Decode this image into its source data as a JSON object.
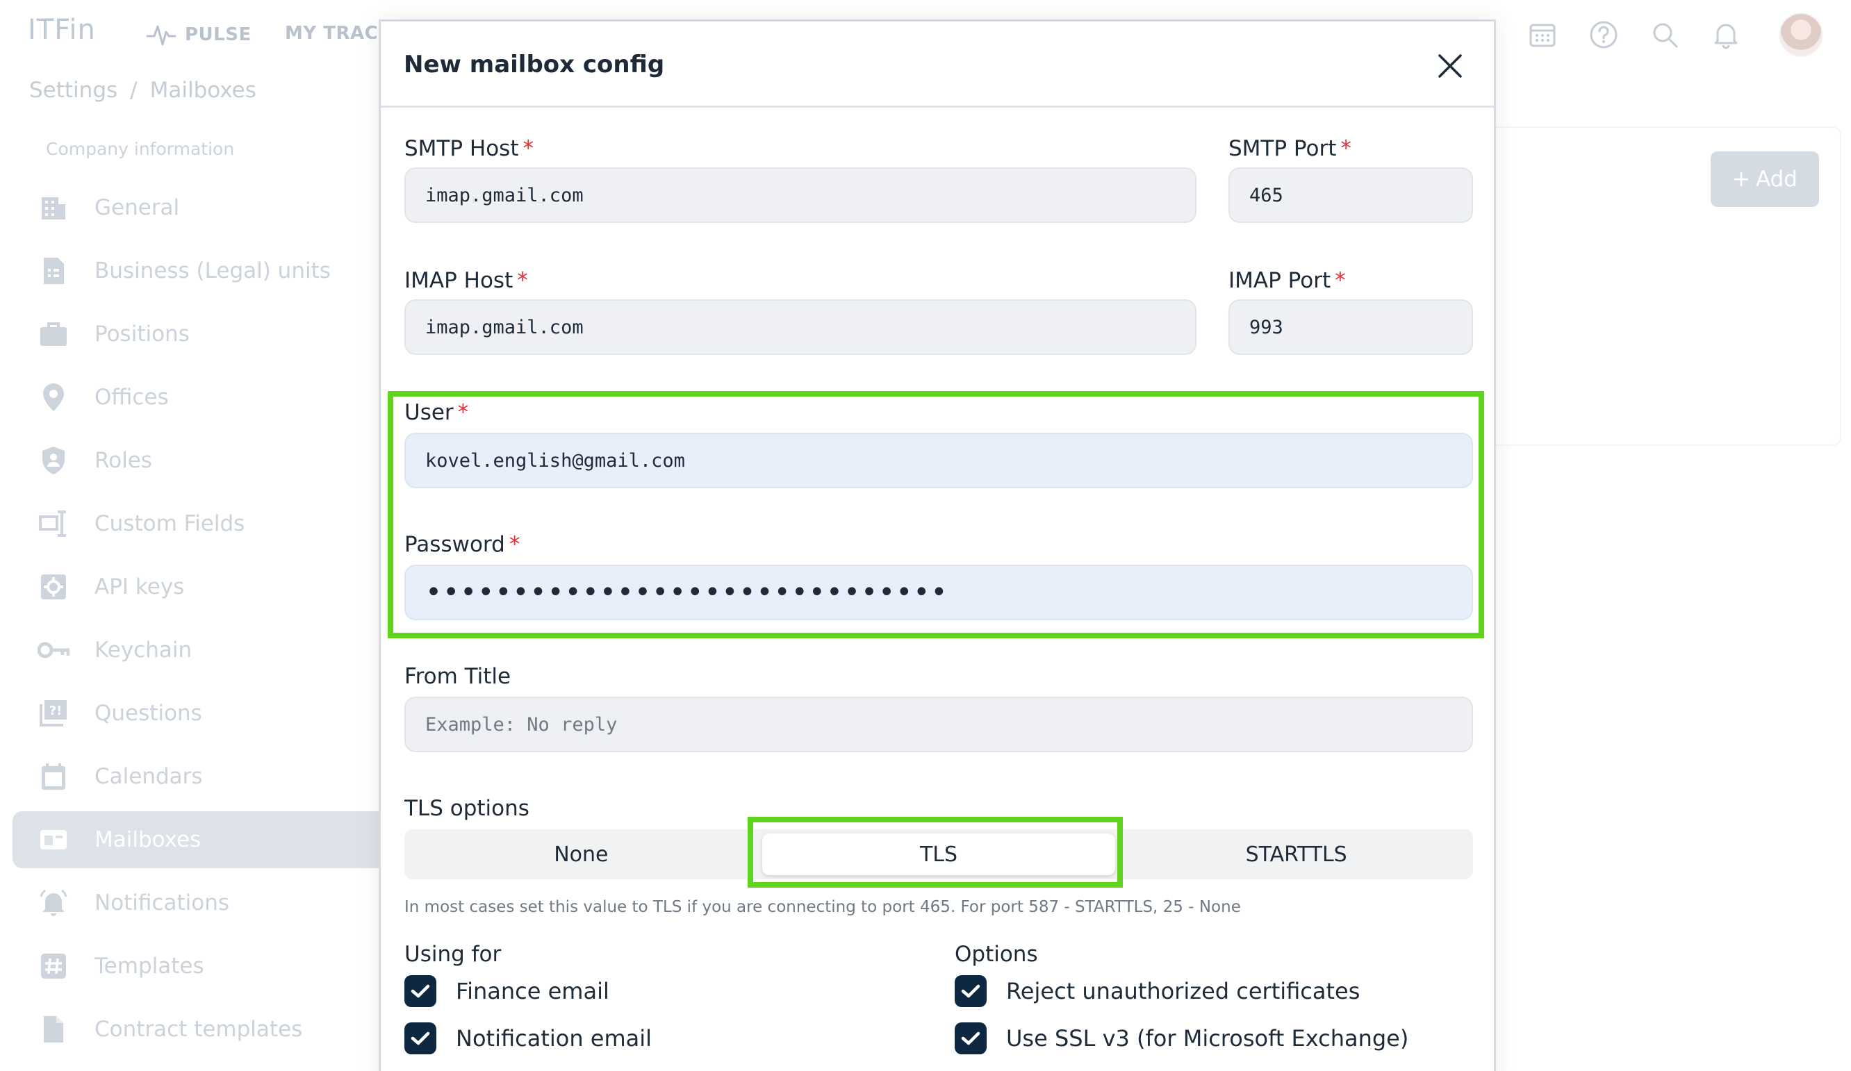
{
  "app": {
    "logo": "ITFin",
    "nav_pulse": "PULSE",
    "nav_tracker": "MY TRACKER"
  },
  "breadcrumb": {
    "root": "Settings",
    "separator": "/",
    "current": "Mailboxes"
  },
  "sidebar": {
    "heading": "Company information",
    "items": [
      {
        "label": "General",
        "icon": "building-icon"
      },
      {
        "label": "Business (Legal) units",
        "icon": "document-icon"
      },
      {
        "label": "Positions",
        "icon": "briefcase-icon"
      },
      {
        "label": "Offices",
        "icon": "location-pin-icon"
      },
      {
        "label": "Roles",
        "icon": "shield-user-icon"
      },
      {
        "label": "Custom Fields",
        "icon": "custom-field-icon"
      },
      {
        "label": "API keys",
        "icon": "api-gear-icon"
      },
      {
        "label": "Keychain",
        "icon": "key-icon"
      },
      {
        "label": "Questions",
        "icon": "question-board-icon"
      },
      {
        "label": "Calendars",
        "icon": "calendar-icon"
      },
      {
        "label": "Mailboxes",
        "icon": "mailbox-icon",
        "active": true
      },
      {
        "label": "Notifications",
        "icon": "bell-icon"
      },
      {
        "label": "Templates",
        "icon": "hash-icon"
      },
      {
        "label": "Contract templates",
        "icon": "file-icon"
      }
    ]
  },
  "page": {
    "add_label": "Add"
  },
  "modal": {
    "title": "New mailbox config",
    "smtp_host": {
      "label": "SMTP Host",
      "value": "imap.gmail.com"
    },
    "smtp_port": {
      "label": "SMTP Port",
      "value": "465"
    },
    "imap_host": {
      "label": "IMAP Host",
      "value": "imap.gmail.com"
    },
    "imap_port": {
      "label": "IMAP Port",
      "value": "993"
    },
    "user": {
      "label": "User",
      "value": "kovel.english@gmail.com"
    },
    "password": {
      "label": "Password",
      "value": "password12345678901234567890ab"
    },
    "from_title": {
      "label": "From Title",
      "placeholder": "Example: No reply"
    },
    "required_mark": "*",
    "tls": {
      "label": "TLS options",
      "options": [
        "None",
        "TLS",
        "STARTTLS"
      ],
      "selected": "TLS",
      "hint": "In most cases set this value to TLS if you are connecting to port 465. For port 587 - STARTTLS, 25 - None"
    },
    "using_for": {
      "title": "Using for",
      "items": [
        {
          "label": "Finance email",
          "checked": true
        },
        {
          "label": "Notification email",
          "checked": true
        }
      ]
    },
    "options": {
      "title": "Options",
      "items": [
        {
          "label": "Reject unauthorized certificates",
          "checked": true
        },
        {
          "label": "Use SSL v3 (for Microsoft Exchange)",
          "checked": true
        }
      ]
    }
  },
  "colors": {
    "highlight": "#5ed41e",
    "checkbox": "#0d2840",
    "required": "#d9363e",
    "active_sidebar": "#c5cdd8"
  }
}
